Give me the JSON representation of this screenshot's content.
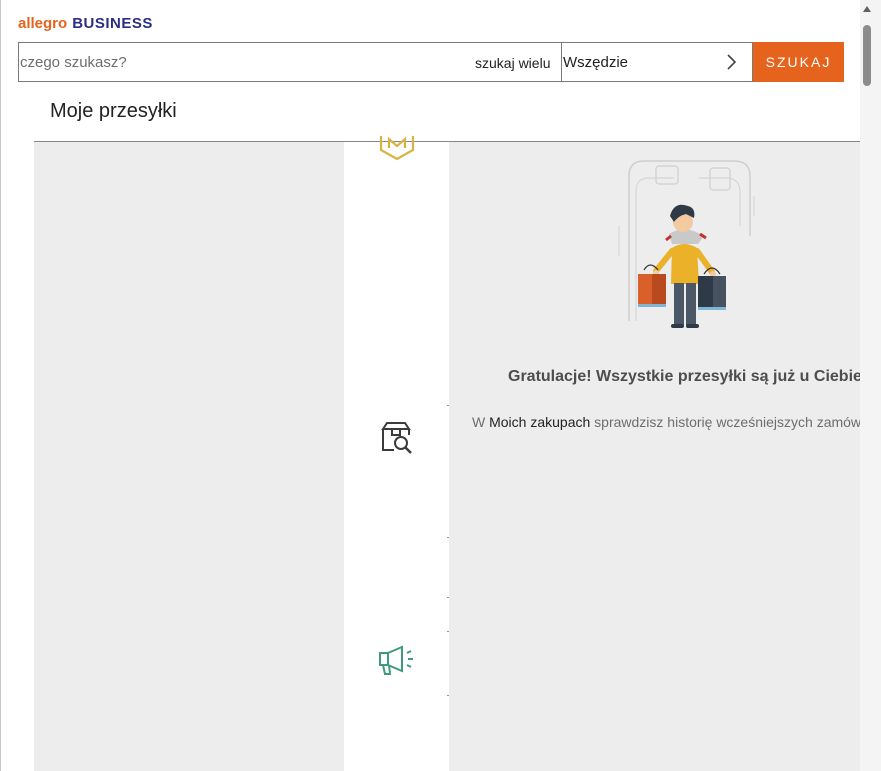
{
  "header": {
    "logo_part1": "allegro",
    "logo_part2": "BUSINESS",
    "search_placeholder": "czego szukasz?",
    "search_many": "szukaj wielu",
    "scope": "Wszędzie",
    "submit_label": "SZUKAJ"
  },
  "page": {
    "title": "Moje przesyłki"
  },
  "empty_state": {
    "heading": "Gratulacje! Wszystkie przesyłki są już u Ciebie.",
    "line_prefix": "W ",
    "line_link": "Moich zakupach",
    "line_suffix": " sprawdzisz historię wcześniejszych zamówień."
  },
  "icons": {
    "top": "smart-badge-icon",
    "middle": "package-search-icon",
    "bottom": "megaphone-icon"
  },
  "colors": {
    "accent": "#e5631d",
    "brand_navy": "#2b2e83",
    "badge_gold": "#d9b342",
    "megaphone_green": "#3f9a7d"
  }
}
